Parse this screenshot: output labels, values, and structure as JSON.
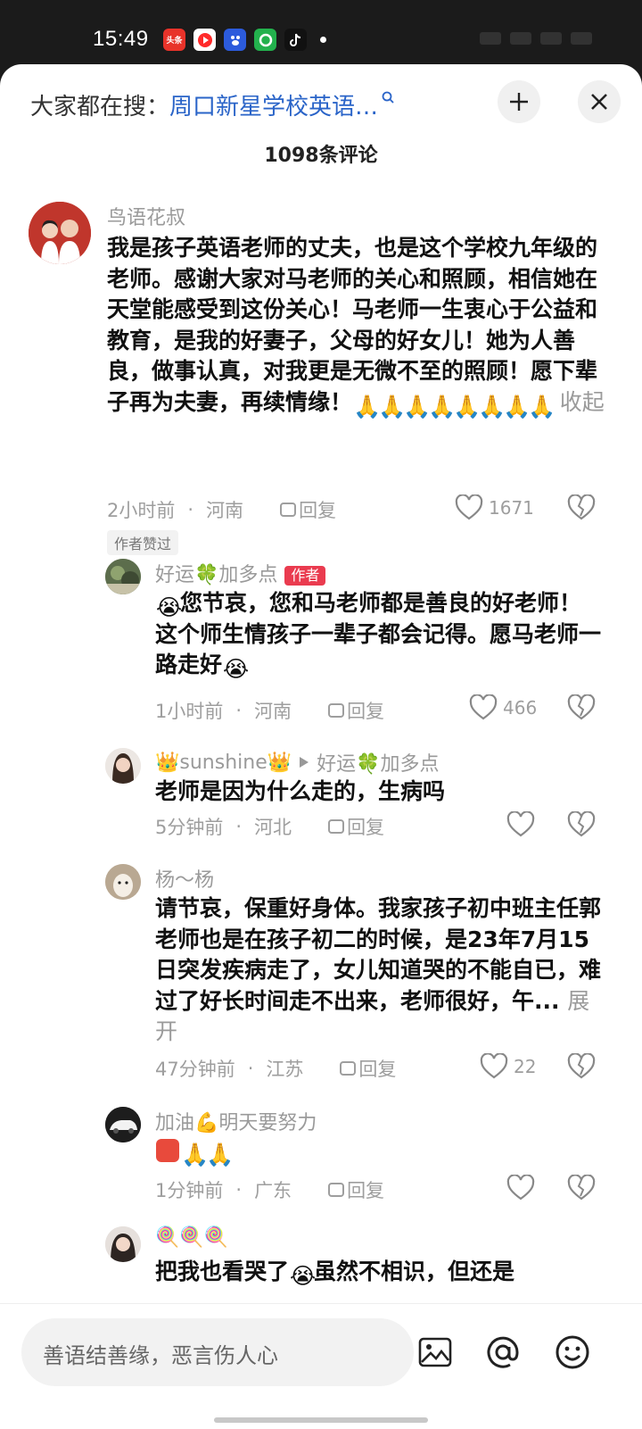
{
  "status_bar": {
    "time": "15:49",
    "apps": [
      {
        "name": "toutiao-app-icon",
        "label": "头条",
        "color": "#e8332a"
      },
      {
        "name": "video-app-icon",
        "label": "",
        "color": "#ff2a2a"
      },
      {
        "name": "baidu-app-icon",
        "label": "",
        "color": "#2c5bdc"
      },
      {
        "name": "green-app-icon",
        "label": "",
        "color": "#23b14d"
      },
      {
        "name": "tiktok-app-icon",
        "label": "",
        "color": "#111111"
      }
    ]
  },
  "header": {
    "search_prefix": "大家都在搜：",
    "search_term": "周口新星学校英语…",
    "comment_count": "1098条评论"
  },
  "comments": [
    {
      "username": "鸟语花叔",
      "text": "我是孩子英语老师的丈夫，也是这个学校九年级的老师。感谢大家对马老师的关心和照顾，相信她在天堂能感受到这份关心！马老师一生衷心于公益和教育，是我的好妻子，父母的好女儿！她为人善良，做事认真，对我更是无微不至的照顾！愿下辈子再为夫妻，再续情缘！",
      "collapse_label": "收起",
      "time": "2小时前",
      "location": "河南",
      "reply_label": "回复",
      "likes": "1671",
      "author_liked_tag": "作者赞过"
    },
    {
      "username": "好运🍀加多点",
      "author_tag": "作者",
      "text_after_emoji": "您节哀，您和马老师都是善良的好老师！这个师生情孩子一辈子都会记得。愿马老师一路走好",
      "time": "1小时前",
      "location": "河南",
      "reply_label": "回复",
      "likes": "466"
    },
    {
      "username": "👑sunshine👑",
      "reply_to": "好运🍀加多点",
      "text": "老师是因为什么走的，生病吗",
      "time": "5分钟前",
      "location": "河北"
    },
    {
      "username": "杨～杨",
      "text": "请节哀，保重好身体。我家孩子初中班主任郭老师也是在孩子初二的时候，是23年7月15日突发疾病走了，女儿知道哭的不能自已，难过了好长时间走不出来，老师很好，午...",
      "expand_label": "展开",
      "time": "47分钟前",
      "location": "江苏",
      "reply_label": "回复",
      "likes": "22"
    },
    {
      "username": "加油💪明天要努力",
      "time": "1分钟前",
      "location": "广东",
      "reply_label": "回复"
    },
    {
      "username": "🍭🍭🍭",
      "text_before_emoji": "把我也看哭了",
      "text_after_emoji": "虽然不相识，但还是"
    }
  ],
  "bottom_bar": {
    "input_placeholder": "善语结善缘，恶言伤人心"
  },
  "colors": {
    "accent_blue": "#2a64c8",
    "author_tag_red": "#ea3b4f"
  }
}
